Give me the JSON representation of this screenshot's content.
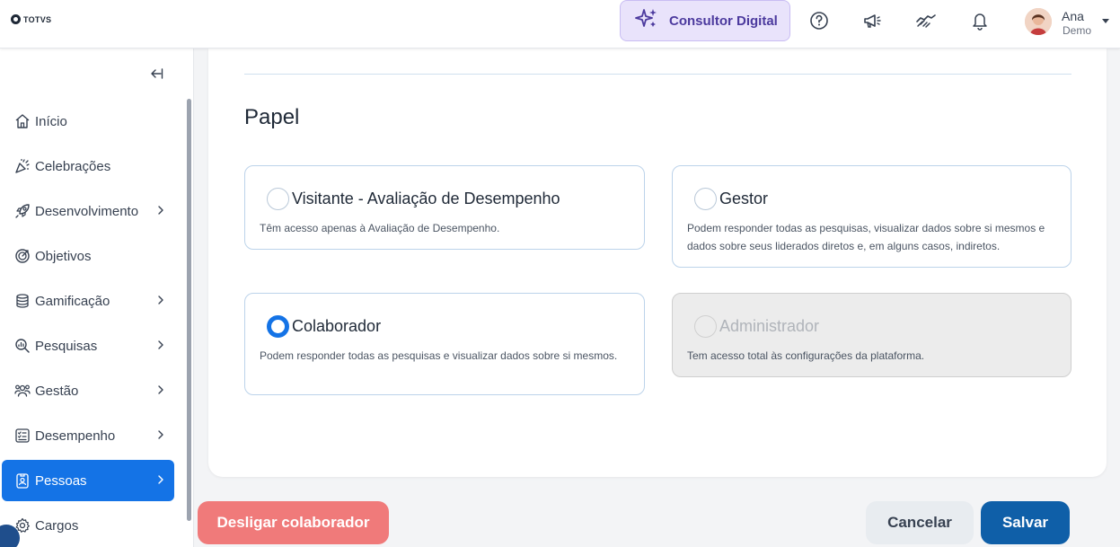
{
  "header": {
    "logo_text": "TOTVS",
    "consultor_label": "Consultor Digital",
    "user": {
      "name": "Ana",
      "role": "Demo"
    },
    "icons": [
      "help-circle-icon",
      "megaphone-icon",
      "handshake-icon",
      "bell-icon"
    ]
  },
  "sidebar": {
    "items": [
      {
        "label": "Início",
        "icon": "home-icon",
        "has_submenu": false,
        "active": false
      },
      {
        "label": "Celebrações",
        "icon": "party-popper-icon",
        "has_submenu": false,
        "active": false
      },
      {
        "label": "Desenvolvimento",
        "icon": "rocket-icon",
        "has_submenu": true,
        "active": false
      },
      {
        "label": "Objetivos",
        "icon": "target-icon",
        "has_submenu": false,
        "active": false
      },
      {
        "label": "Gamificação",
        "icon": "coins-icon",
        "has_submenu": true,
        "active": false
      },
      {
        "label": "Pesquisas",
        "icon": "search-chart-icon",
        "has_submenu": true,
        "active": false
      },
      {
        "label": "Gestão",
        "icon": "people-icon",
        "has_submenu": true,
        "active": false
      },
      {
        "label": "Desempenho",
        "icon": "checklist-icon",
        "has_submenu": true,
        "active": false
      },
      {
        "label": "Pessoas",
        "icon": "id-badge-icon",
        "has_submenu": true,
        "active": true
      },
      {
        "label": "Cargos",
        "icon": "gear-icon",
        "has_submenu": false,
        "active": false
      }
    ]
  },
  "main": {
    "section_title": "Papel",
    "roles": [
      {
        "title": "Visitante - Avaliação de Desempenho",
        "description": "Têm acesso apenas à Avaliação de Desempenho.",
        "selected": false,
        "disabled": false
      },
      {
        "title": "Gestor",
        "description": "Podem responder todas as pesquisas, visualizar dados sobre si mesmos e dados sobre seus liderados diretos e, em alguns casos, indiretos.",
        "selected": false,
        "disabled": false
      },
      {
        "title": "Colaborador",
        "description": "Podem responder todas as pesquisas e visualizar dados sobre si mesmos.",
        "selected": true,
        "disabled": false
      },
      {
        "title": "Administrador",
        "description": "Tem acesso total às configurações da plataforma.",
        "selected": false,
        "disabled": true
      }
    ]
  },
  "footer": {
    "desligar_label": "Desligar colaborador",
    "cancelar_label": "Cancelar",
    "salvar_label": "Salvar"
  },
  "colors": {
    "accent": "#1473e6",
    "danger": "#f07a7a",
    "primary_button": "#0f5fa8",
    "consultor_bg": "#e9e3fb"
  }
}
